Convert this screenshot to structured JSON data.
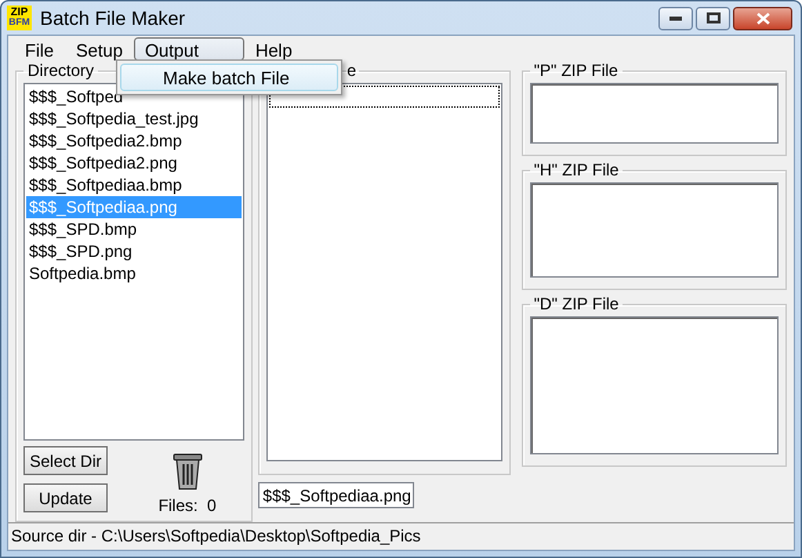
{
  "window": {
    "title": "Batch File Maker",
    "app_icon": {
      "top": "ZIP",
      "bottom": "BFM"
    }
  },
  "menu": [
    {
      "label": "File",
      "selected": false
    },
    {
      "label": "Setup",
      "selected": false
    },
    {
      "label": "Output",
      "selected": true
    },
    {
      "label": "Help",
      "selected": false
    }
  ],
  "open_menu": {
    "items": [
      "Make batch File"
    ]
  },
  "directory": {
    "label": "Directory",
    "files": [
      {
        "name": "$$$_Softped",
        "selected": false
      },
      {
        "name": "$$$_Softpedia_test.jpg",
        "selected": false
      },
      {
        "name": "$$$_Softpedia2.bmp",
        "selected": false
      },
      {
        "name": "$$$_Softpedia2.png",
        "selected": false
      },
      {
        "name": "$$$_Softpediaa.bmp",
        "selected": false
      },
      {
        "name": "$$$_Softpediaa.png",
        "selected": true
      },
      {
        "name": "$$$_SPD.bmp",
        "selected": false
      },
      {
        "name": "$$$_SPD.png",
        "selected": false
      },
      {
        "name": "Softpedia.bmp",
        "selected": false
      }
    ]
  },
  "buttons": [
    "Select Dir",
    "Update"
  ],
  "files_count": "Files:  0",
  "batch": {
    "label": "e",
    "file_name": "$$$_Softpediaa.png"
  },
  "zip_files": [
    {
      "label": "\"P\" ZIP File"
    },
    {
      "label": "\"H\" ZIP File"
    },
    {
      "label": "\"D\" ZIP File"
    }
  ],
  "status_bar": "Source dir - C:\\Users\\Softpedia\\Desktop\\Softpedia_Pics"
}
